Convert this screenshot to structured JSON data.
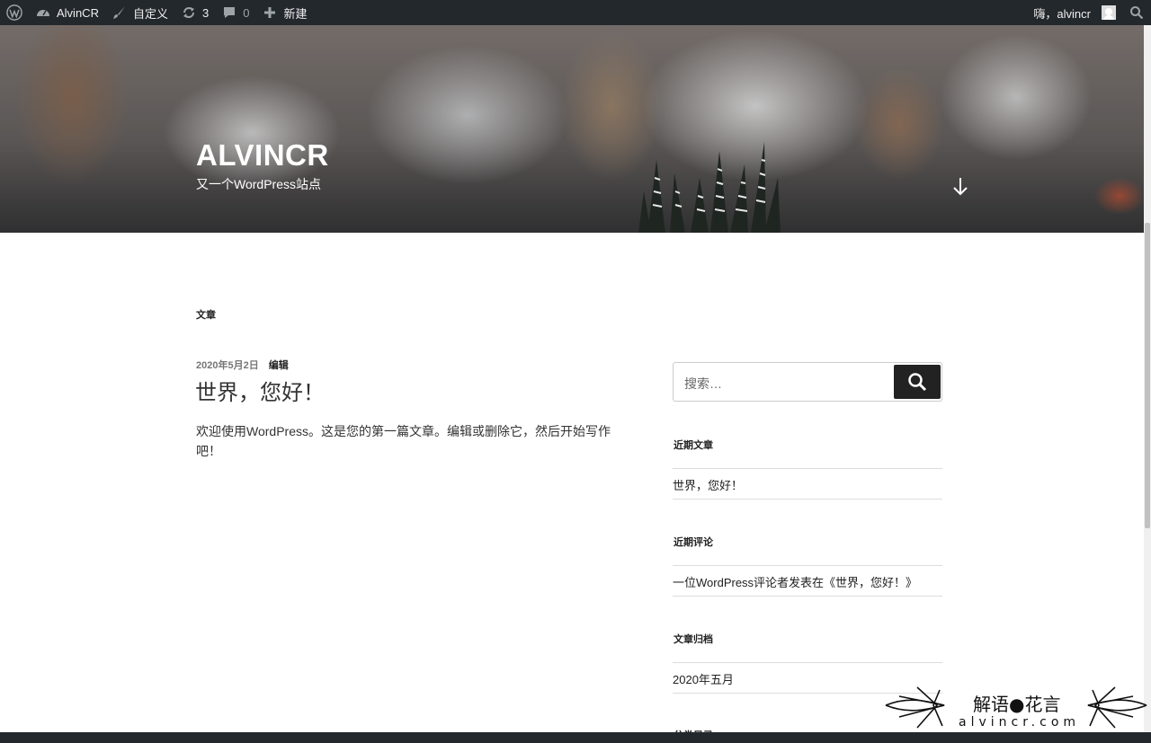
{
  "adminbar": {
    "site_name": "AlvinCR",
    "customize": "自定义",
    "updates_count": "3",
    "comments_count": "0",
    "new_label": "新建",
    "greeting": "嗨，alvincr"
  },
  "header": {
    "site_title": "ALVINCR",
    "site_description": "又一个WordPress站点"
  },
  "main": {
    "page_heading": "文章",
    "post": {
      "date": "2020年5月2日",
      "edit": "编辑",
      "title": "世界，您好！",
      "body": "欢迎使用WordPress。这是您的第一篇文章。编辑或删除它，然后开始写作吧！"
    }
  },
  "sidebar": {
    "search_placeholder": "搜索…",
    "recent_posts_title": "近期文章",
    "recent_posts": [
      "世界，您好！"
    ],
    "recent_comments_title": "近期评论",
    "recent_comments": [
      "一位WordPress评论者发表在《世界，您好！》"
    ],
    "archives_title": "文章归档",
    "archives": [
      "2020年五月"
    ],
    "categories_title": "分类目录"
  },
  "watermark": {
    "title": "解语●花言",
    "sub": "alvincr.com"
  },
  "colors": {
    "adminbar_bg": "#23282d",
    "search_button_bg": "#222222"
  }
}
